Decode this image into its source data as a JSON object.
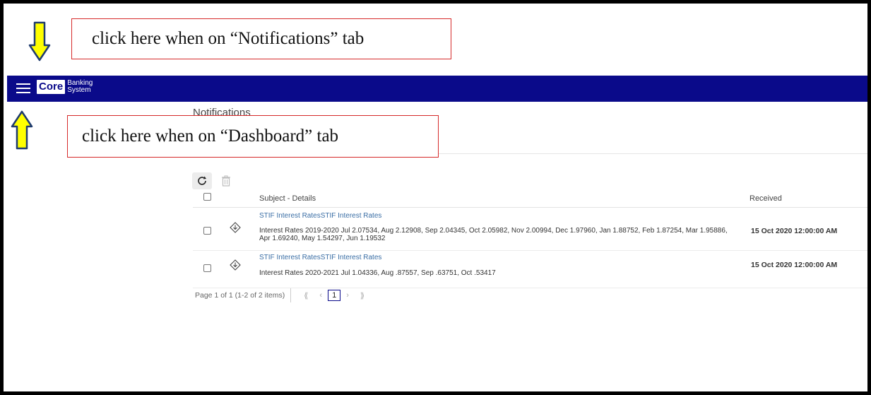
{
  "annotations": {
    "top_text": "click here when on “Notifications” tab",
    "bottom_text": "click here when on “Dashboard” tab",
    "arrow_color": "#ffff00"
  },
  "header": {
    "bar_color": "#0a0a8a",
    "logo_core": "Core",
    "logo_sub_1": "Banking",
    "logo_sub_2": "System"
  },
  "page": {
    "title": "Notifications"
  },
  "toolbar": {
    "refresh_icon": "refresh-icon",
    "delete_icon": "trash-icon"
  },
  "grid": {
    "col_subject": "Subject - Details",
    "col_received": "Received",
    "rows": [
      {
        "subject": "STIF Interest RatesSTIF Interest Rates",
        "details": "Interest Rates 2019-2020 Jul 2.07534, Aug 2.12908, Sep 2.04345, Oct 2.05982, Nov 2.00994, Dec 1.97960, Jan 1.88752, Feb 1.87254, Mar 1.95886, Apr 1.69240, May 1.54297, Jun 1.19532",
        "received": "15 Oct 2020 12:00:00 AM"
      },
      {
        "subject": "STIF Interest RatesSTIF Interest Rates",
        "details": "Interest Rates 2020-2021 Jul 1.04336, Aug .87557, Sep .63751, Oct .53417",
        "received": "15 Oct 2020 12:00:00 AM"
      }
    ]
  },
  "pager": {
    "page_label": "Page",
    "page_current": "1",
    "page_of": "of 1",
    "items_info": "(1-2 of 2 items)",
    "first": "⟪",
    "prev": "‹",
    "page_button": "1",
    "next": "›",
    "last": "⟫"
  }
}
